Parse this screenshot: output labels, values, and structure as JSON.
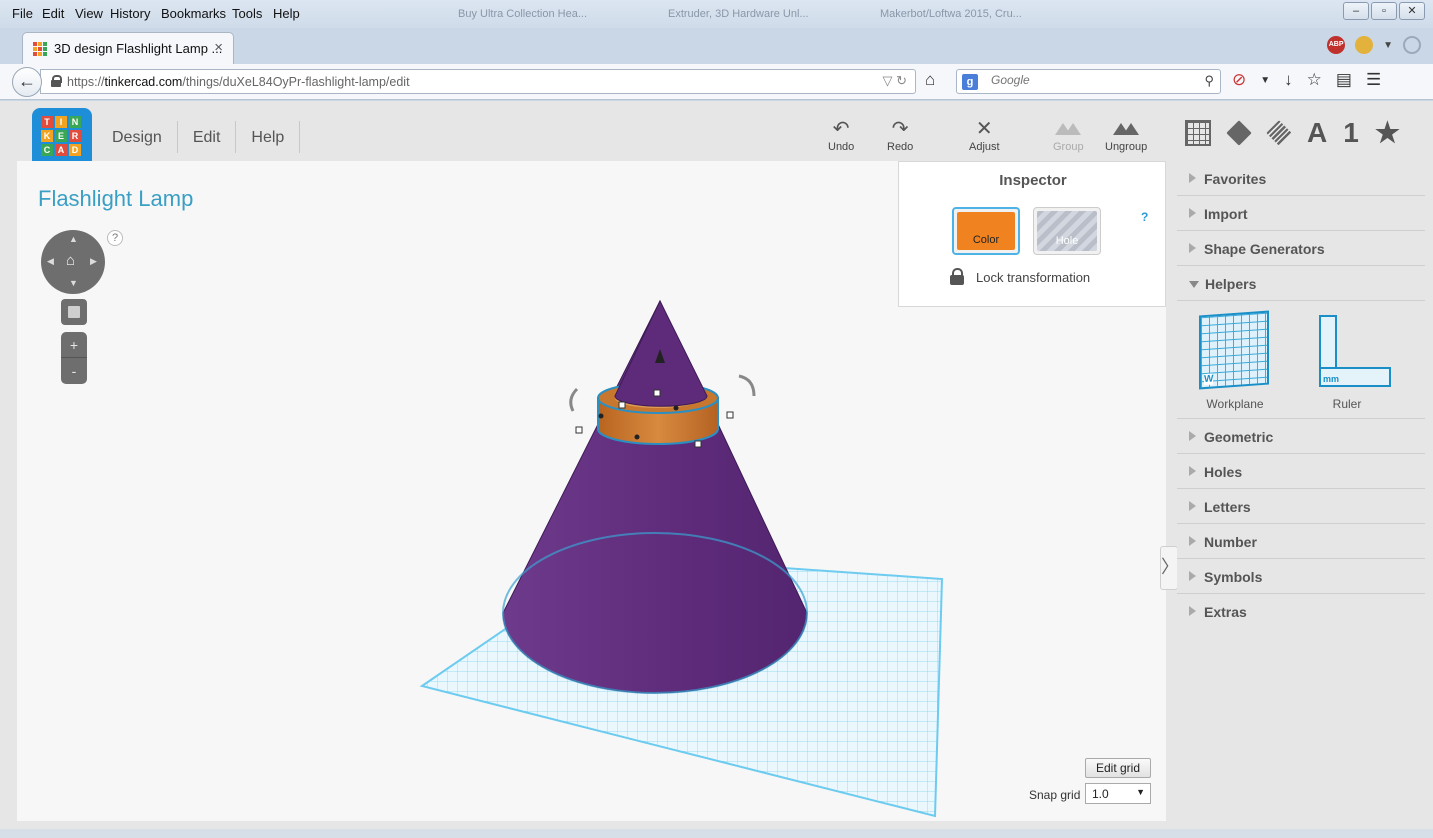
{
  "browser": {
    "menu": [
      "File",
      "Edit",
      "View",
      "History",
      "Bookmarks",
      "Tools",
      "Help"
    ],
    "background_tabs": [
      "Buy Ultra Collection Hea...",
      "Extruder, 3D Hardware Unl...",
      "Makerbot/Loftwa 2015, Cru..."
    ],
    "active_tab": {
      "title": "3D design Flashlight Lamp ...",
      "close": "×"
    },
    "back": "←",
    "url": {
      "prefix": "https://",
      "domain": "tinkercad.com",
      "path": "/things/duXeL84OyPr-flashlight-lamp/edit"
    },
    "url_controls": "▽ ↻",
    "home": "⌂",
    "search": {
      "engine": "g",
      "placeholder": "Google",
      "icon": "⚲"
    },
    "toolbar_icons": [
      "download-icon",
      "star-icon",
      "reading-list-icon",
      "menu-icon"
    ]
  },
  "app": {
    "logo": [
      "T",
      "I",
      "N",
      "K",
      "E",
      "R",
      "C",
      "A",
      "D"
    ],
    "menu": [
      "Design",
      "Edit",
      "Help"
    ],
    "tools": {
      "undo": {
        "label": "Undo",
        "icon": "↶"
      },
      "redo": {
        "label": "Redo",
        "icon": "↷"
      },
      "adjust": {
        "label": "Adjust",
        "icon": "✕"
      },
      "group": {
        "label": "Group"
      },
      "ungroup": {
        "label": "Ungroup"
      }
    },
    "view_switch": {
      "letter": "A",
      "number": "1",
      "star": "★"
    },
    "design_title": "Flashlight Lamp",
    "nav": {
      "up": "▲",
      "down": "▼",
      "left": "◀",
      "right": "▶",
      "home": "⌂",
      "help": "?",
      "zoom_in": "+",
      "zoom_out": "-"
    },
    "inspector": {
      "title": "Inspector",
      "help": "?",
      "color_label": "Color",
      "hole_label": "Hole",
      "lock_label": "Lock transformation"
    },
    "grid": {
      "edit_label": "Edit grid",
      "snap_label": "Snap grid",
      "snap_value": "1.0",
      "caret": "▼"
    },
    "collapse": "〉",
    "side_panel": {
      "sections": [
        "Favorites",
        "Import",
        "Shape Generators",
        "Helpers",
        "Geometric",
        "Holes",
        "Letters",
        "Number",
        "Symbols",
        "Extras"
      ],
      "helpers": [
        {
          "label": "Workplane",
          "mark": "W"
        },
        {
          "label": "Ruler",
          "mark": "mm"
        }
      ]
    },
    "colors": {
      "accent": "#3a9fc4",
      "shape_purple": "#5e2b7a",
      "ring_orange": "#c8772f",
      "grid_blue": "#6ccbef"
    }
  }
}
